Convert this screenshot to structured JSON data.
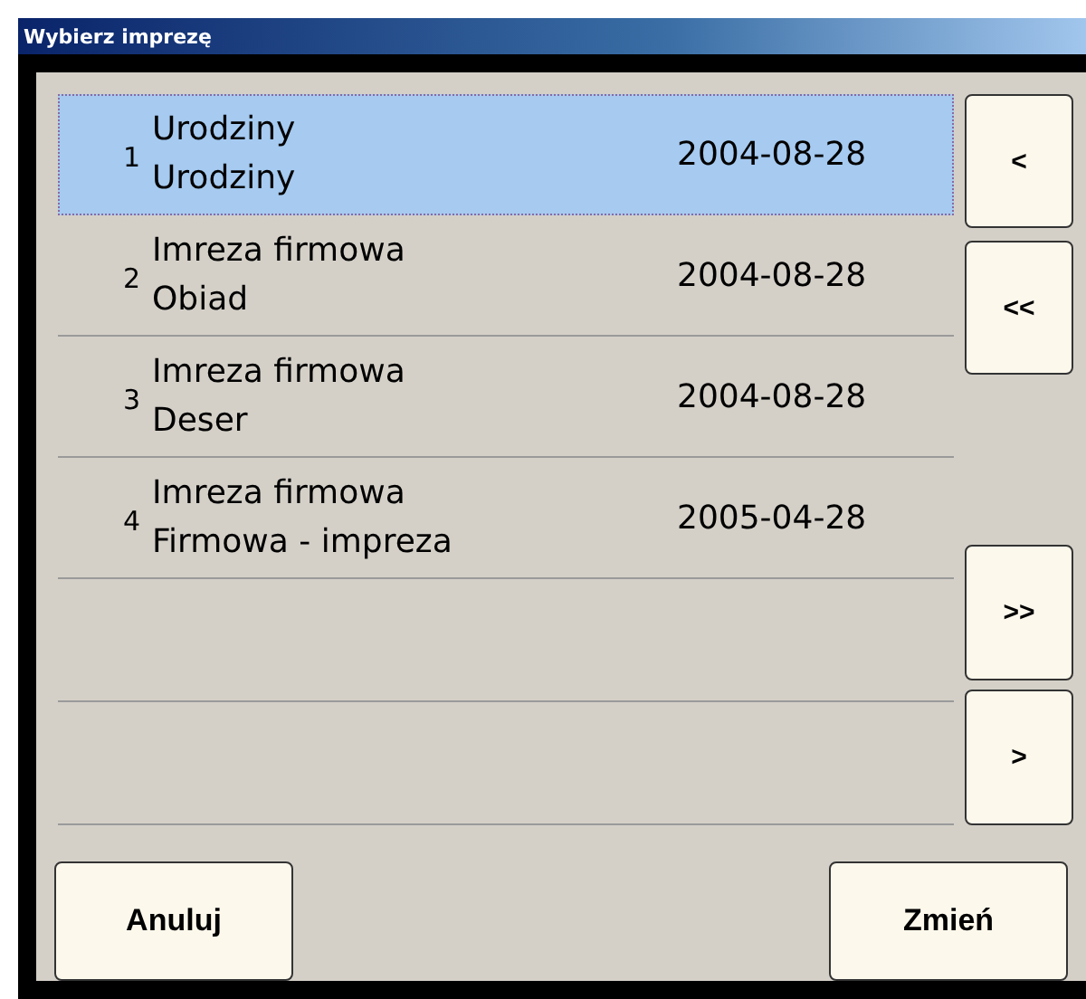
{
  "window": {
    "title": "Wybierz imprezę"
  },
  "events": [
    {
      "number": "1",
      "name": "Urodziny",
      "subtitle": "Urodziny",
      "date": "2004-08-28",
      "selected": true
    },
    {
      "number": "2",
      "name": "Imreza firmowa",
      "subtitle": "Obiad",
      "date": "2004-08-28",
      "selected": false
    },
    {
      "number": "3",
      "name": "Imreza firmowa",
      "subtitle": "Deser",
      "date": "2004-08-28",
      "selected": false
    },
    {
      "number": "4",
      "name": "Imreza firmowa",
      "subtitle": "Firmowa - impreza",
      "date": "2005-04-28",
      "selected": false
    }
  ],
  "nav_buttons_top": [
    "<",
    "<<"
  ],
  "nav_buttons_bottom": [
    ">>",
    ">"
  ],
  "buttons": {
    "cancel": "Anuluj",
    "change": "Zmień"
  }
}
